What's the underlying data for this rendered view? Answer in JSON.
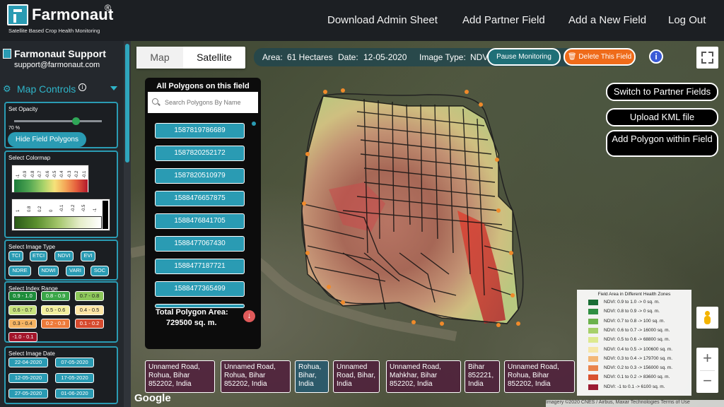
{
  "header": {
    "brand": "Farmonaut",
    "registered": "®",
    "tagline": "Satellite Based Crop Health Monitoring",
    "nav": [
      "Download Admin Sheet",
      "Add Partner Field",
      "Add a New Field",
      "Log Out"
    ]
  },
  "support": {
    "title": "Farmonaut Support",
    "email": "support@farmonaut.com"
  },
  "map_controls": {
    "title": "Map Controls",
    "opacity_label": "Set Opacity",
    "opacity_value": "70 %",
    "opacity_fraction": 0.7,
    "hide_polygons_label": "Hide Field Polygons",
    "colormap_label": "Select Colormap",
    "colormap1_ticks": [
      "-1",
      "-0.9",
      "-0.8",
      "-0.7",
      "-0.6",
      "-0.5",
      "-0.4",
      "-0.3",
      "-0.2",
      "-0.1"
    ],
    "colormap2_ticks": [
      "1",
      "0.8",
      "0.2",
      "0",
      "-0.1",
      "-0.2",
      "-0.5",
      "-1"
    ],
    "image_type_label": "Select Image Type",
    "image_types_row1": [
      "TCI",
      "ETCI",
      "NDVI",
      "EVI"
    ],
    "image_types_row2": [
      "NDRE",
      "NDWI",
      "VARI",
      "SOC"
    ],
    "index_range_label": "Select Index Range",
    "index_ranges": [
      {
        "label": "0.9 - 1.0",
        "color": "#1e8c3a",
        "text": "#ffffff"
      },
      {
        "label": "0.8 - 0.9",
        "color": "#3aa648",
        "text": "#ffffff"
      },
      {
        "label": "0.7 - 0.8",
        "color": "#8dc75a",
        "text": "#222222"
      },
      {
        "label": "0.6 - 0.7",
        "color": "#c7e27e",
        "text": "#222222"
      },
      {
        "label": "0.5 - 0.6",
        "color": "#f3ef9e",
        "text": "#222222"
      },
      {
        "label": "0.4 - 0.5",
        "color": "#fde5a6",
        "text": "#222222"
      },
      {
        "label": "0.3 - 0.4",
        "color": "#f6b463",
        "text": "#222222"
      },
      {
        "label": "0.2 - 0.3",
        "color": "#ec7a3a",
        "text": "#ffffff"
      },
      {
        "label": "0.1 - 0.2",
        "color": "#d64a2e",
        "text": "#ffffff"
      },
      {
        "label": "-1.0 - 0.1",
        "color": "#a3152a",
        "text": "#ffffff"
      }
    ],
    "image_date_label": "Select Image Date",
    "dates": [
      "22-04-2020",
      "07-05-2020",
      "12-05-2020",
      "17-05-2020",
      "27-05-2020",
      "01-06-2020"
    ]
  },
  "map": {
    "tab_map": "Map",
    "tab_satellite": "Satellite",
    "area_label": "Area:",
    "area_value": "61 Hectares",
    "date_label": "Date:",
    "date_value": "12-05-2020",
    "image_type_label": "Image Type:",
    "image_type_value": "NDVI",
    "pause_label": "Pause Monitoring",
    "delete_label": "Delete This Field",
    "switch_partner": "Switch to Partner Fields",
    "upload_kml": "Upload KML file",
    "add_polygon": "Add Polygon within Field",
    "google": "Google",
    "attribution": "Imagery ©2020 CNES / Airbus, Maxar Technologies   Terms of Use"
  },
  "polygons": {
    "title": "All Polygons on this field",
    "search_placeholder": "Search Polygons By Name",
    "ids": [
      "1587819786689",
      "1587820252172",
      "1587820510979",
      "1588476657875",
      "1588476841705",
      "1588477067430",
      "1588477187721",
      "1588477365499"
    ],
    "total_label": "Total Polygon Area:",
    "total_value": "729500 sq. m."
  },
  "legend": {
    "title": "Field Area in Different Health Zones",
    "rows": [
      {
        "label": "NDVI: 0.9 to 1.0 -> 0 sq. m.",
        "color": "#1a6e35"
      },
      {
        "label": "NDVI: 0.8 to 0.9 -> 0 sq. m.",
        "color": "#2f8f42"
      },
      {
        "label": "NDVI: 0.7 to 0.8 -> 100 sq. m.",
        "color": "#6cb24d"
      },
      {
        "label": "NDVI: 0.6 to 0.7 -> 16000 sq. m.",
        "color": "#a6d06a"
      },
      {
        "label": "NDVI: 0.5 to 0.6 -> 68800 sq. m.",
        "color": "#dde98f"
      },
      {
        "label": "NDVI: 0.4 to 0.5 -> 100600 sq. m.",
        "color": "#f6e7a8"
      },
      {
        "label": "NDVI: 0.3 to 0.4 -> 179700 sq. m.",
        "color": "#f3b776"
      },
      {
        "label": "NDVI: 0.2 to 0.3 -> 156000 sq. m.",
        "color": "#e9834c"
      },
      {
        "label": "NDVI: 0.1 to 0.2 -> 83600 sq. m.",
        "color": "#d9512f"
      },
      {
        "label": "NDVI: -1 to 0.1 -> 6100 sq. m.",
        "color": "#9b1b33"
      }
    ]
  },
  "addresses": [
    {
      "lines": [
        "Unnamed Road,",
        "Rohua, Bihar",
        "852202, India"
      ],
      "variant": "purple"
    },
    {
      "lines": [
        "Unnamed Road,",
        "Rohua, Bihar",
        "852202, India"
      ],
      "variant": "purple"
    },
    {
      "lines": [
        "Rohua,",
        "Bihar,",
        "India"
      ],
      "variant": "teal"
    },
    {
      "lines": [
        "Unnamed",
        "Road, Bihar,",
        "India"
      ],
      "variant": "purple"
    },
    {
      "lines": [
        "Unnamed Road,",
        "Mahkhar, Bihar",
        "852202, India"
      ],
      "variant": "purple"
    },
    {
      "lines": [
        "Bihar",
        "852221,",
        "India"
      ],
      "variant": "purple"
    },
    {
      "lines": [
        "Unnamed Road,",
        "Rohua, Bihar",
        "852202, India"
      ],
      "variant": "purple"
    }
  ]
}
